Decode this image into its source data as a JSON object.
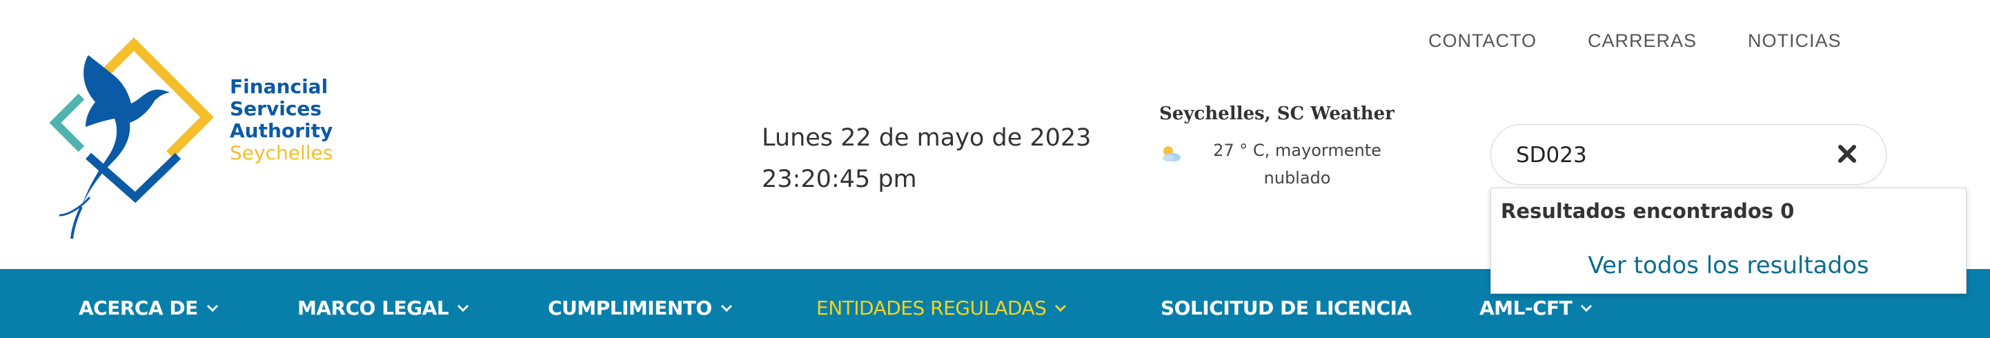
{
  "logo": {
    "line1": "Financial",
    "line2": "Services",
    "line3": "Authority",
    "line4": "Seychelles"
  },
  "top_nav": {
    "items": [
      {
        "label": "CONTACTO"
      },
      {
        "label": "CARRERAS"
      },
      {
        "label": "NOTICIAS"
      }
    ]
  },
  "datetime": {
    "date": "Lunes 22 de mayo de 2023",
    "time": "23:20:45 pm"
  },
  "weather": {
    "title": "Seychelles, SC Weather",
    "line1": "27 ° C, mayormente",
    "line2": "nublado",
    "icon": "partly-cloudy-icon"
  },
  "search": {
    "value": "SD023",
    "clear_icon": "close-icon"
  },
  "results": {
    "count_label": "Resultados encontrados 0",
    "view_all_label": "Ver todos los resultados"
  },
  "main_nav": {
    "items": [
      {
        "label": "ACERCA DE"
      },
      {
        "label": "MARCO LEGAL"
      },
      {
        "label": "CUMPLIMIENTO"
      },
      {
        "label": "ENTIDADES REGULADAS"
      },
      {
        "label": "SOLICITUD DE LICENCIA"
      },
      {
        "label": "AML-CFT"
      }
    ]
  },
  "colors": {
    "nav_bg": "#087faa",
    "nav_active": "#f7d21c",
    "brand_blue": "#0b5aa6",
    "brand_gold": "#f5be2a",
    "brand_teal": "#4fb3b0"
  }
}
